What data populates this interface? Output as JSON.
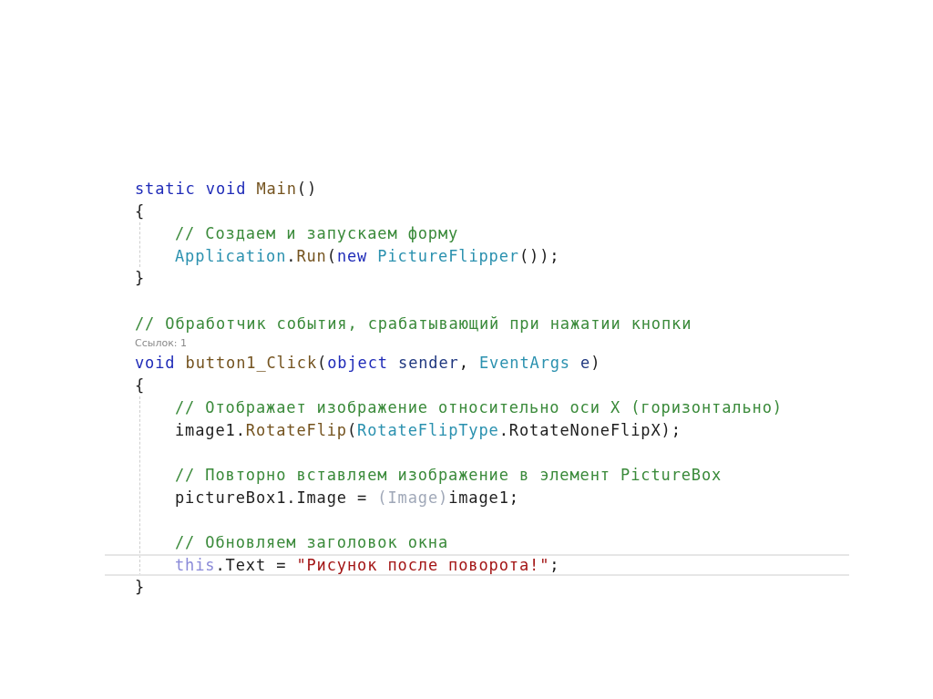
{
  "code": [
    {
      "kind": "code",
      "current": false,
      "tokens": [
        {
          "t": "static void ",
          "kind": "keyword"
        },
        {
          "t": "Main",
          "kind": "method"
        },
        {
          "t": "()",
          "kind": "plain"
        }
      ]
    },
    {
      "kind": "code",
      "current": false,
      "tokens": [
        {
          "t": "{",
          "kind": "plain"
        }
      ]
    },
    {
      "kind": "block",
      "children": [
        {
          "kind": "code",
          "current": false,
          "tokens": [
            {
              "t": "// Создаем и запускаем форму",
              "kind": "comment"
            }
          ]
        },
        {
          "kind": "code",
          "current": false,
          "tokens": [
            {
              "t": "Application",
              "kind": "type"
            },
            {
              "t": ".",
              "kind": "plain"
            },
            {
              "t": "Run",
              "kind": "method"
            },
            {
              "t": "(",
              "kind": "plain"
            },
            {
              "t": "new ",
              "kind": "keyword"
            },
            {
              "t": "PictureFlipper",
              "kind": "type"
            },
            {
              "t": "());",
              "kind": "plain"
            }
          ]
        }
      ]
    },
    {
      "kind": "code",
      "current": false,
      "tokens": [
        {
          "t": "}",
          "kind": "plain"
        }
      ]
    },
    {
      "kind": "blank"
    },
    {
      "kind": "code",
      "current": false,
      "tokens": [
        {
          "t": "// Обработчик события, срабатывающий при нажатии кнопки",
          "kind": "comment"
        }
      ]
    },
    {
      "kind": "lens",
      "text": "Ссылок: 1"
    },
    {
      "kind": "code",
      "current": false,
      "tokens": [
        {
          "t": "void ",
          "kind": "keyword"
        },
        {
          "t": "button1_Click",
          "kind": "method"
        },
        {
          "t": "(",
          "kind": "plain"
        },
        {
          "t": "object ",
          "kind": "keyword"
        },
        {
          "t": "sender",
          "kind": "param"
        },
        {
          "t": ", ",
          "kind": "plain"
        },
        {
          "t": "EventArgs ",
          "kind": "type"
        },
        {
          "t": "e",
          "kind": "param"
        },
        {
          "t": ")",
          "kind": "plain"
        }
      ]
    },
    {
      "kind": "code",
      "current": false,
      "tokens": [
        {
          "t": "{",
          "kind": "plain"
        }
      ]
    },
    {
      "kind": "block",
      "children": [
        {
          "kind": "code",
          "current": false,
          "tokens": [
            {
              "t": "// Отображает изображение относительно оси X (горизонтально)",
              "kind": "comment"
            }
          ]
        },
        {
          "kind": "code",
          "current": false,
          "tokens": [
            {
              "t": "image1",
              "kind": "plain"
            },
            {
              "t": ".",
              "kind": "plain"
            },
            {
              "t": "RotateFlip",
              "kind": "method"
            },
            {
              "t": "(",
              "kind": "plain"
            },
            {
              "t": "RotateFlipType",
              "kind": "type"
            },
            {
              "t": ".RotateNoneFlipX);",
              "kind": "plain"
            }
          ]
        },
        {
          "kind": "blank"
        },
        {
          "kind": "code",
          "current": false,
          "tokens": [
            {
              "t": "// Повторно вставляем изображение в элемент PictureBox",
              "kind": "comment"
            }
          ]
        },
        {
          "kind": "code",
          "current": false,
          "tokens": [
            {
              "t": "pictureBox1.Image = ",
              "kind": "plain"
            },
            {
              "t": "(Image)",
              "kind": "faded"
            },
            {
              "t": "image1;",
              "kind": "plain"
            }
          ]
        },
        {
          "kind": "blank"
        },
        {
          "kind": "code",
          "current": false,
          "tokens": [
            {
              "t": "// Обновляем заголовок окна",
              "kind": "comment"
            }
          ]
        },
        {
          "kind": "code",
          "current": true,
          "tokens": [
            {
              "t": "this",
              "kind": "faded-keyword"
            },
            {
              "t": ".Text = ",
              "kind": "plain"
            },
            {
              "t": "\"Рисунок после поворота!\"",
              "kind": "string"
            },
            {
              "t": ";",
              "kind": "plain"
            }
          ]
        }
      ]
    },
    {
      "kind": "code",
      "current": false,
      "tokens": [
        {
          "t": "}",
          "kind": "plain"
        }
      ]
    }
  ]
}
